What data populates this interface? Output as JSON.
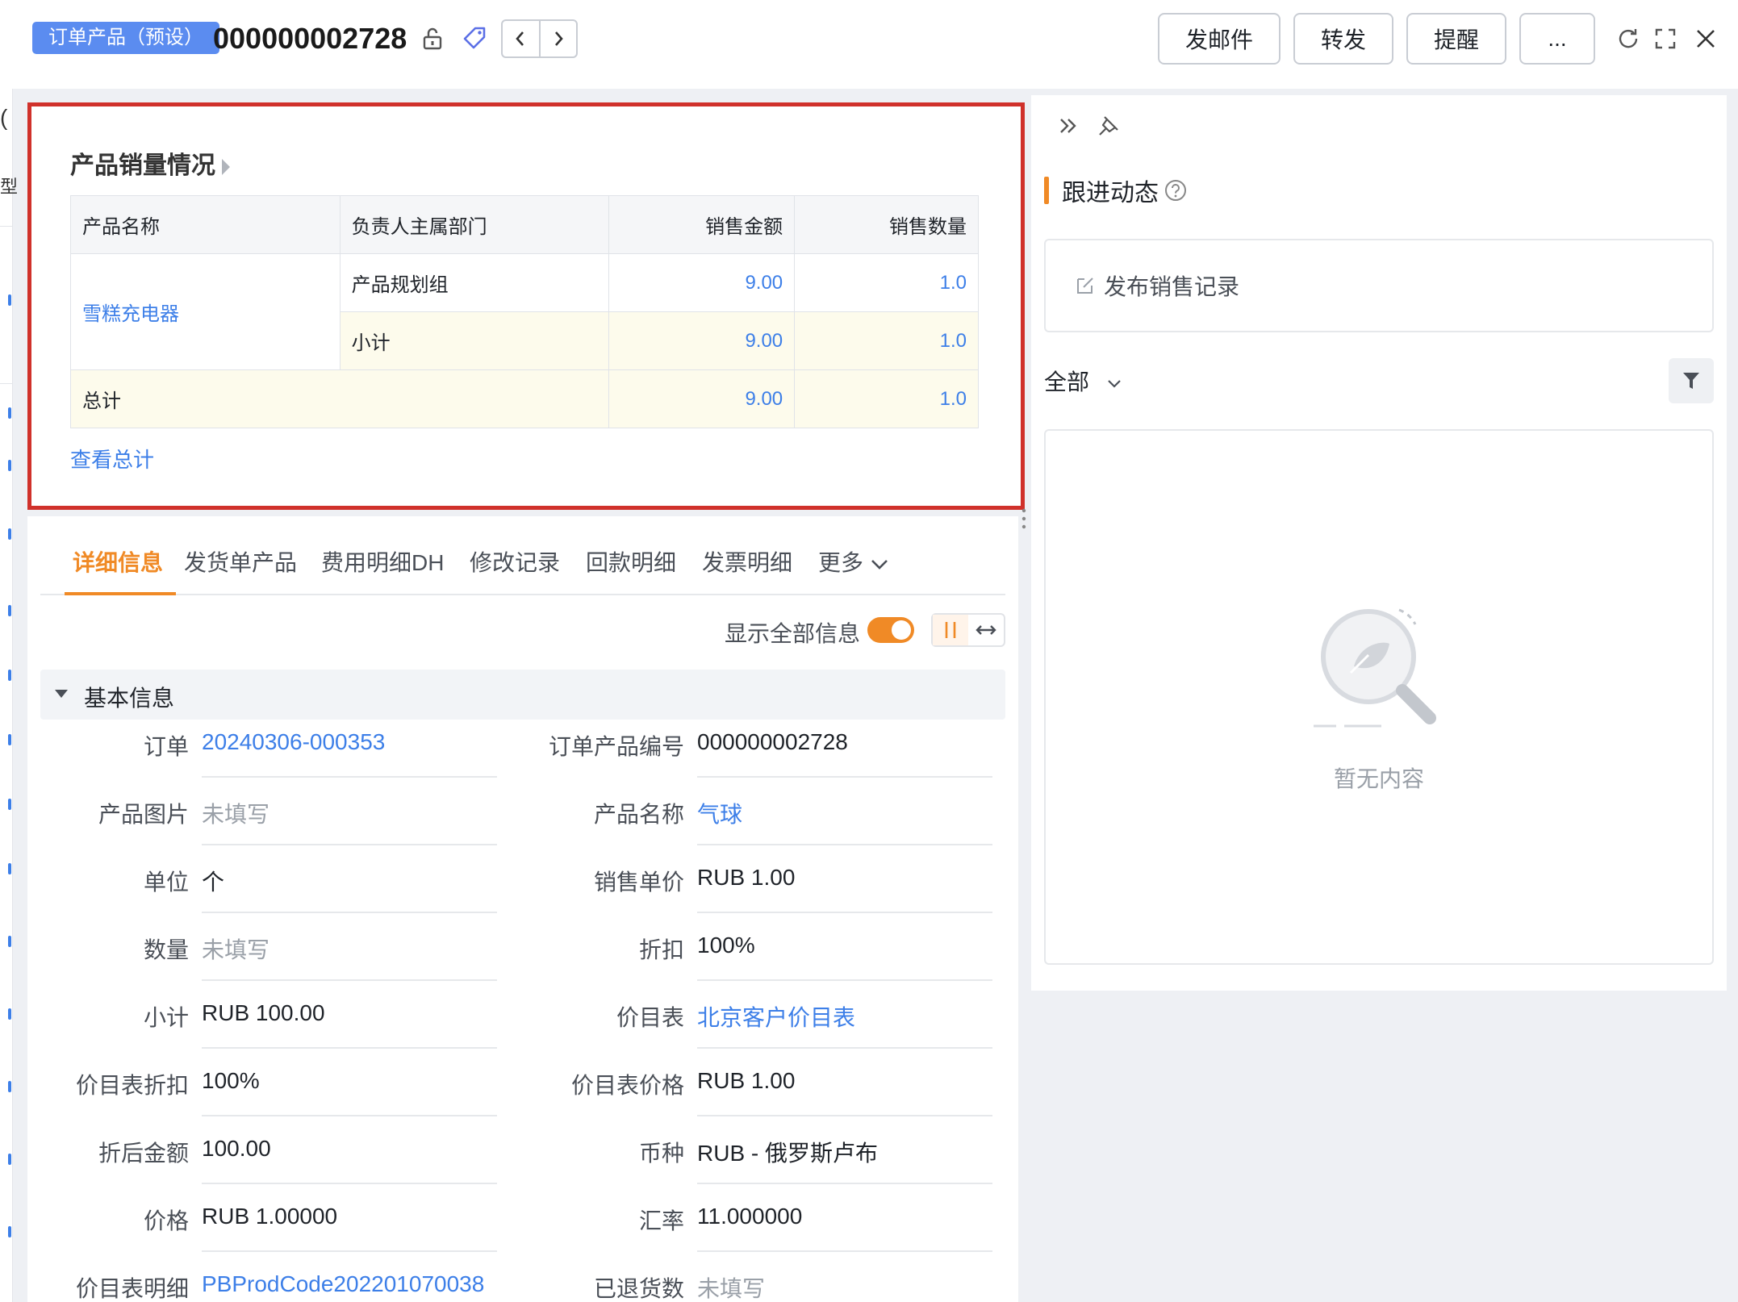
{
  "header": {
    "badge": "订单产品（预设）",
    "record_number": "000000002728",
    "buttons": {
      "email": "发邮件",
      "forward": "转发",
      "remind": "提醒",
      "more": "..."
    }
  },
  "left_strip": {
    "labels": [
      "(",
      "型"
    ]
  },
  "sales_card": {
    "title": "产品销量情况",
    "columns": [
      "产品名称",
      "负责人主属部门",
      "销售金额",
      "销售数量"
    ],
    "group": {
      "product": "雪糕充电器",
      "rows": [
        {
          "dept": "产品规划组",
          "amount": "9.00",
          "qty": "1.0"
        },
        {
          "dept": "小计",
          "amount": "9.00",
          "qty": "1.0"
        }
      ]
    },
    "total": {
      "label": "总计",
      "amount": "9.00",
      "qty": "1.0"
    },
    "view_total": "查看总计"
  },
  "tabs": {
    "items": [
      "详细信息",
      "发货单产品",
      "费用明细DH",
      "修改记录",
      "回款明细",
      "发票明细",
      "更多"
    ],
    "active": "详细信息"
  },
  "detail": {
    "show_all_label": "显示全部信息",
    "show_all_on": true,
    "section_title": "基本信息",
    "left_fields": [
      {
        "label": "订单",
        "value": "20240306-000353",
        "kind": "link"
      },
      {
        "label": "产品图片",
        "value": "未填写",
        "kind": "empty"
      },
      {
        "label": "单位",
        "value": "个",
        "kind": "text"
      },
      {
        "label": "数量",
        "value": "未填写",
        "kind": "empty"
      },
      {
        "label": "小计",
        "value": "RUB 100.00",
        "kind": "text"
      },
      {
        "label": "价目表折扣",
        "value": "100%",
        "kind": "text"
      },
      {
        "label": "折后金额",
        "value": "100.00",
        "kind": "text"
      },
      {
        "label": "价格",
        "value": "RUB 1.00000",
        "kind": "text"
      },
      {
        "label": "价目表明细",
        "value": "PBProdCode202201070038",
        "kind": "link"
      }
    ],
    "right_fields": [
      {
        "label": "订单产品编号",
        "value": "000000002728",
        "kind": "text"
      },
      {
        "label": "产品名称",
        "value": "气球",
        "kind": "link"
      },
      {
        "label": "销售单价",
        "value": "RUB 1.00",
        "kind": "text"
      },
      {
        "label": "折扣",
        "value": "100%",
        "kind": "text"
      },
      {
        "label": "价目表",
        "value": "北京客户价目表",
        "kind": "link"
      },
      {
        "label": "价目表价格",
        "value": "RUB 1.00",
        "kind": "text"
      },
      {
        "label": "币种",
        "value": "RUB - 俄罗斯卢布",
        "kind": "text"
      },
      {
        "label": "汇率",
        "value": "11.000000",
        "kind": "text"
      },
      {
        "label": "已退货数",
        "value": "未填写",
        "kind": "empty"
      }
    ]
  },
  "right_panel": {
    "title": "跟进动态",
    "post_label": "发布销售记录",
    "filter_label": "全部",
    "empty_text": "暂无内容"
  },
  "colors": {
    "accent": "#f08a26",
    "link": "#3d7fe8",
    "badge": "#5b8cf0",
    "highlight_border": "#d0312b"
  }
}
